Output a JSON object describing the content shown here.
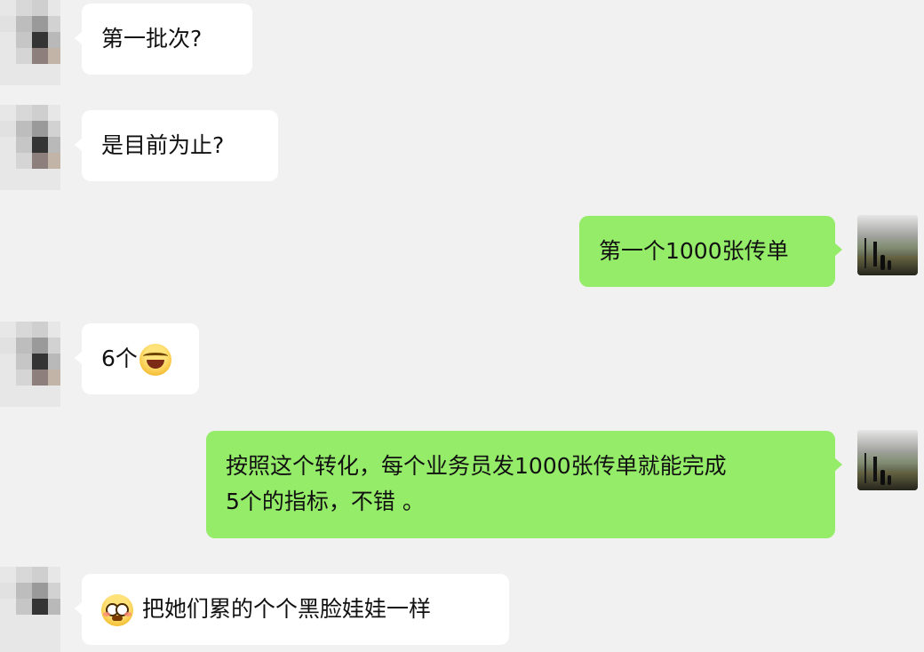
{
  "messages": [
    {
      "side": "left",
      "text": "第一批次?"
    },
    {
      "side": "left",
      "text": "是目前为止?"
    },
    {
      "side": "right",
      "text": "第一个1000张传单"
    },
    {
      "side": "left",
      "text": "6个",
      "emoji": "face-with-tears-of-joy-icon"
    },
    {
      "side": "right",
      "line1": "按照这个转化，每个业务员发1000张传单就能完成",
      "line2": "5个的指标，不错 。"
    },
    {
      "side": "left",
      "emoji": "flushed-face-icon",
      "text": "把她们累的个个黑脸娃娃一样"
    }
  ],
  "colors": {
    "background": "#f1f1f1",
    "incoming_bubble": "#ffffff",
    "outgoing_bubble": "#95ec69"
  }
}
